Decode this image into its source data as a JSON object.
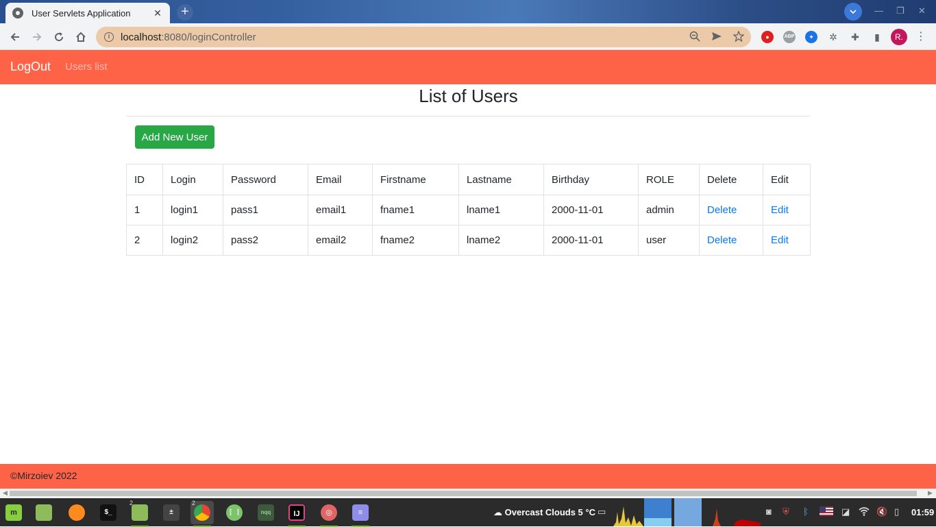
{
  "browser": {
    "tab_title": "User Servlets Application",
    "tab_close": "✕",
    "new_tab": "+",
    "url_host": "localhost",
    "url_rest": ":8080/loginController",
    "profile_initial": "R."
  },
  "navbar": {
    "brand": "LogOut",
    "link": "Users list"
  },
  "main": {
    "title": "List of Users",
    "add_button": "Add New User",
    "columns": [
      "ID",
      "Login",
      "Password",
      "Email",
      "Firstname",
      "Lastname",
      "Birthday",
      "ROLE",
      "Delete",
      "Edit"
    ],
    "rows": [
      {
        "id": "1",
        "login": "login1",
        "password": "pass1",
        "email": "email1",
        "firstname": "fname1",
        "lastname": "lname1",
        "birthday": "2000-11-01",
        "role": "admin",
        "delete": "Delete",
        "edit": "Edit"
      },
      {
        "id": "2",
        "login": "login2",
        "password": "pass2",
        "email": "email2",
        "firstname": "fname2",
        "lastname": "lname2",
        "birthday": "2000-11-01",
        "role": "user",
        "delete": "Delete",
        "edit": "Edit"
      }
    ]
  },
  "footer": {
    "text": "©Mirzoiev 2022"
  },
  "taskbar": {
    "weather": "Overcast Clouds 5 °C",
    "clock": "01:59",
    "badge_files": "2",
    "badge_chrome": "2",
    "nqq_label": "nqq",
    "ij_label": "IJ"
  },
  "colors": {
    "navbar": "#ff6347",
    "add_button": "#28a745",
    "link": "#007bff"
  }
}
